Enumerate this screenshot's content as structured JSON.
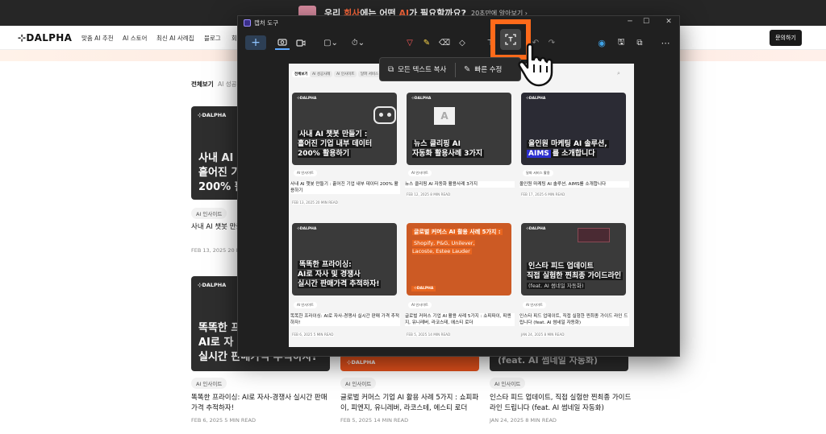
{
  "promo": {
    "lead_a": "우리 ",
    "lead_b": "회사",
    "lead_c": "에는 어떤 ",
    "lead_d": "AI",
    "lead_e": "가 필요할까요?",
    "sub": "20초만에 알아보기",
    "arrow": "›"
  },
  "nav": {
    "logo_mark": "⊹",
    "logo": "DALPHA",
    "items": [
      "맞춤 AI 추천",
      "AI 스토어",
      "최신 AI 사례집",
      "블로그",
      "회"
    ],
    "cta": "문의하기"
  },
  "tabs": {
    "all": "전체보기",
    "partial": "AI 성공사"
  },
  "bg_cards": [
    {
      "logo": "⊹DALPHA",
      "title": "사내 AI 챗봇\n흩어진 기\n200% 활",
      "chip": "AI 인사이트",
      "post": "사내 AI 챗봇 만들\n200% 활용하기",
      "meta": "FEB 13, 2025   20 MI"
    },
    {
      "logo": "⊹DALPHA",
      "title": "똑똑한 프\nAI로 자\n실시간 판매가격 추적하자!",
      "chip": "AI 인사이트",
      "post": "똑똑한 프라이싱: AI로 자사-경쟁사 실시간 판매 가격 추적하자!",
      "meta": "FEB 6, 2025   5 MIN READ"
    },
    {
      "logo": "⊹DALPHA",
      "title": "",
      "chip": "AI 인사이트",
      "post": "글로벌 커머스 기업 AI 활용 사례 5가지 : 쇼피파이, 피엔지, 유니레버, 라코스테, 에스티 로더",
      "meta": "FEB 5, 2025   14 MIN READ"
    },
    {
      "logo": "",
      "title": "(feat. AI 썸네일 자동화)",
      "chip": "AI 인사이트",
      "post": "인스타 피드 업데이트, 직접 실험한 찐최종 가이드 라인 드립니다 (feat. AI 썸네일 자동화)",
      "meta": "JAN 24, 2025   8 MIN READ"
    }
  ],
  "window": {
    "title": "캡처 도구",
    "minimize": "─",
    "maximize": "☐",
    "close": "✕",
    "toolbar": {
      "new": "+",
      "camera": "📷",
      "video": "▭",
      "shape": "▢⌄",
      "timer": "⏱⌄",
      "pen": "▽",
      "highlighter": "✎",
      "eraser": "⌫",
      "lasso": "◇",
      "crop": "⊤",
      "ocr": "⌗",
      "undo": "↶",
      "redo": "↷",
      "edge": "◉",
      "save": "🖫",
      "copy": "⧉",
      "more": "⋯"
    }
  },
  "ocr_menu": {
    "copy_icon": "⧉",
    "copy_all": "모든 텍스트 복사",
    "redact_icon": "✎",
    "redact": "빠른 수정"
  },
  "capture": {
    "tabs": [
      "전체보기",
      "AI 성공사례",
      "AI 인사이트",
      "달파 서비스 활용"
    ],
    "search_icon": "⌕",
    "cards": [
      {
        "logo": "⊹DALPHA",
        "title": "사내 AI 챗봇 만들기 :\n흩어진 기업 내부 데이터\n200% 활용하기",
        "chip": "AI 인사이트",
        "post": "사내 AI 챗봇 만들기 : 흩어진 기업 내부 데이터 200% 활용하기",
        "meta": "FEB 13, 2025   20 MIN READ"
      },
      {
        "logo": "⊹DALPHA",
        "title": "뉴스 클리핑 AI\n자동화 활용사례 3가지",
        "chip": "AI 인사이트",
        "post": "뉴스 클리핑 AI 자동화 활용사례 3가지",
        "meta": "FEB 12, 2025   8 MIN READ",
        "graphic": "A"
      },
      {
        "logo": "⊹DALPHA",
        "title_a": "올인원 마케팅 AI 솔루션,",
        "title_b": "AIMS",
        "title_c": "를 소개합니다",
        "chip": "달파 서비스 활용",
        "post": "올인원 마케팅 AI 솔루션, AIMS를 소개합니다",
        "meta": "FEB 17, 2025   6 MIN READ"
      },
      {
        "logo": "⊹DALPHA",
        "title": "똑똑한 프라이싱:\nAI로 자사 및 경쟁사\n실시간 판매가격 추적하자!",
        "chip": "AI 인사이트",
        "post": "똑똑한 프라이싱: AI로 자사-경쟁사 실시간 판매 가격 추적하자!",
        "meta": "FEB 6, 2025   5 MIN READ"
      },
      {
        "logo": "⊹DALPHA",
        "title": "글로벌 커머스 AI 활용 사례 5가지 :",
        "subtitle": "Shopify, P&G, Unilever,\nLacoste, Estee Lauder",
        "chip": "AI 인사이트",
        "post": "글로벌 커머스 기업 AI 활용 사례 5가지 : 쇼피파이, 피엔지, 유니레버, 라코스테, 에스티 로더",
        "meta": "FEB 5, 2025   14 MIN READ"
      },
      {
        "logo": "⊹DALPHA",
        "title": "인스타 피드 업데이트\n직접 실험한 찐최종 가이드라인",
        "subtitle": "(feat. AI 썸네일 자동화)",
        "chip": "AI 인사이트",
        "post": "인스타 피드 업데이트, 직접 실험한 찐최종 가이드 라인 드립니다 (feat. AI 썸네일 자동화)",
        "meta": "JAN 24, 2025   8 MIN READ"
      }
    ]
  },
  "colors": {
    "accent": "#ff6a1a",
    "promo_highlight": "#ff6a3d",
    "aims_highlight": "#2c2fd0"
  }
}
